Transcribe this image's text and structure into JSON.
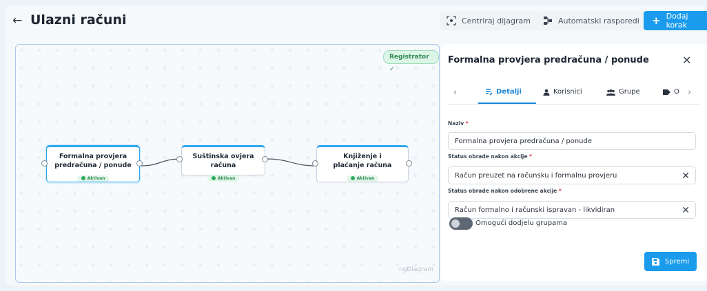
{
  "header": {
    "title": "Ulazni računi",
    "center_label": "Centriraj dijagram",
    "auto_label": "Automatski rasporedi",
    "add_label": "Dodaj korak"
  },
  "diagram": {
    "badge": "Registrator ✓",
    "watermark": "ngDiagram",
    "nodes": [
      {
        "title": "Formalna provjera predračuna / ponude",
        "status": "Aktivan"
      },
      {
        "title": "Suštinska ovjera računa",
        "status": "Aktivan"
      },
      {
        "title": "Knjiženje i plaćanje računa",
        "status": "Aktivan"
      }
    ]
  },
  "panel": {
    "title": "Formalna provjera predračuna / ponude",
    "tabs": [
      "Detalji",
      "Korisnici",
      "Grupe",
      "O"
    ],
    "fields": [
      {
        "label": "Naziv",
        "value": "Formalna provjera predračuna / ponude"
      },
      {
        "label": "Status obrade nakon akcije",
        "value": "Račun preuzet na računsku i formalnu provjeru"
      },
      {
        "label": "Status obrade nakon odobrene akcije",
        "value": "Račun formalno i računski ispravan - likvidiran"
      }
    ],
    "toggle_label": "Omogući dodjelu grupama",
    "save_label": "Spremi"
  },
  "colors": {
    "accent": "#1a9bec",
    "active_green": "#2eaa5f",
    "node_border": "#2ba8ef"
  }
}
